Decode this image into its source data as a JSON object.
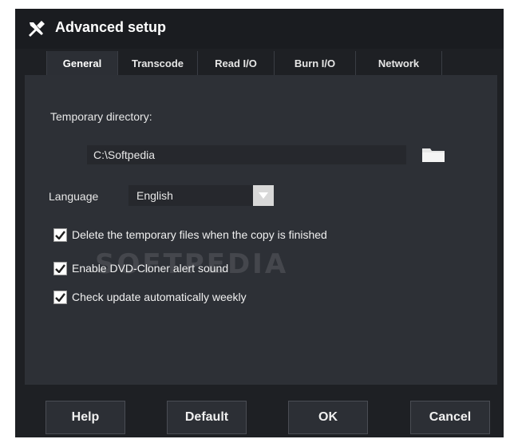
{
  "window": {
    "title": "Advanced setup",
    "title_icon": "tools-icon"
  },
  "tabs": [
    {
      "label": "General",
      "active": true
    },
    {
      "label": "Transcode",
      "active": false
    },
    {
      "label": "Read I/O",
      "active": false
    },
    {
      "label": "Burn I/O",
      "active": false
    },
    {
      "label": "Network",
      "active": false
    }
  ],
  "general": {
    "temp_dir_label": "Temporary directory:",
    "temp_dir_value": "C:\\Softpedia",
    "browse_icon": "folder-icon",
    "language_label": "Language",
    "language_value": "English",
    "checkboxes": [
      {
        "label": "Delete the temporary files when the copy is finished",
        "checked": true
      },
      {
        "label": "Enable DVD-Cloner alert sound",
        "checked": true
      },
      {
        "label": "Check update automatically weekly",
        "checked": true
      }
    ]
  },
  "watermark": "SOFTPEDIA",
  "buttons": {
    "help": "Help",
    "default": "Default",
    "ok": "OK",
    "cancel": "Cancel"
  },
  "colors": {
    "window_bg": "#1e2024",
    "panel_bg": "#2d3036",
    "field_bg": "#26282d",
    "text": "#e8e8e8"
  }
}
